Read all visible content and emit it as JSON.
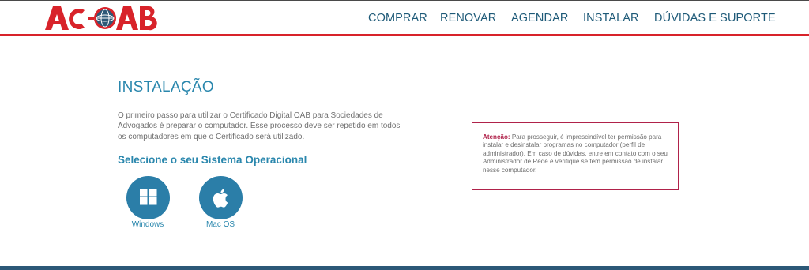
{
  "header": {
    "logo_text": "AC-OAB",
    "nav": [
      {
        "label": "COMPRAR"
      },
      {
        "label": "RENOVAR"
      },
      {
        "label": "AGENDAR"
      },
      {
        "label": "INSTALAR"
      },
      {
        "label": "DÚVIDAS E SUPORTE"
      }
    ]
  },
  "main": {
    "title": "INSTALAÇÃO",
    "intro": "O primeiro passo para utilizar o Certificado Digital OAB para Sociedades de Advogados é preparar o computador. Esse processo deve ser repetido em todos os computadores em que o Certificado será utilizado.",
    "select_heading": "Selecione o seu Sistema Operacional",
    "os_options": [
      {
        "label": "Windows",
        "icon": "windows-icon"
      },
      {
        "label": "Mac OS",
        "icon": "apple-icon"
      }
    ]
  },
  "notice": {
    "strong": "Atenção:",
    "text": " Para prosseguir, é imprescindível ter permissão para instalar e desinstalar programas no computador (perfil de administrador). Em caso de dúvidas, entre em contato com o seu Administrador de Rede e verifique se tem permissão de instalar nesse computador."
  },
  "colors": {
    "accent_blue": "#2a87ad",
    "nav_blue": "#1e5a78",
    "brand_red": "#d8232a",
    "notice_border": "#b0224a",
    "footer": "#2c5877"
  }
}
